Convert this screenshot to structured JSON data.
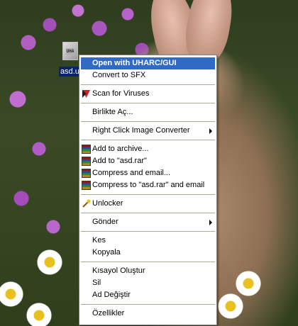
{
  "desktop": {
    "file_icon_glyph": "UHA",
    "file_label": "asd.u"
  },
  "context_menu": {
    "items": [
      {
        "label": "Open with UHARC/GUI",
        "default": true,
        "selected": true
      },
      {
        "label": "Convert to SFX"
      },
      {
        "label": "Scan for Viruses",
        "icon": "antivirus-icon"
      },
      {
        "label": "Birlikte Aç..."
      },
      {
        "label": "Right Click Image Converter",
        "submenu": true
      },
      {
        "label": "Add to archive...",
        "icon": "winrar-icon"
      },
      {
        "label": "Add to \"asd.rar\"",
        "icon": "winrar-icon"
      },
      {
        "label": "Compress and email...",
        "icon": "winrar-icon"
      },
      {
        "label": "Compress to \"asd.rar\" and email",
        "icon": "winrar-icon"
      },
      {
        "label": "Unlocker",
        "icon": "unlocker-wand-icon"
      },
      {
        "label": "Gönder",
        "submenu": true
      },
      {
        "label": "Kes"
      },
      {
        "label": "Kopyala"
      },
      {
        "label": "Kısayol Oluştur"
      },
      {
        "label": "Sil"
      },
      {
        "label": "Ad Değiştir"
      },
      {
        "label": "Özellikler"
      }
    ]
  },
  "colors": {
    "selection": "#316ac5",
    "menu_background": "#ffffff",
    "separator": "#aca899"
  }
}
